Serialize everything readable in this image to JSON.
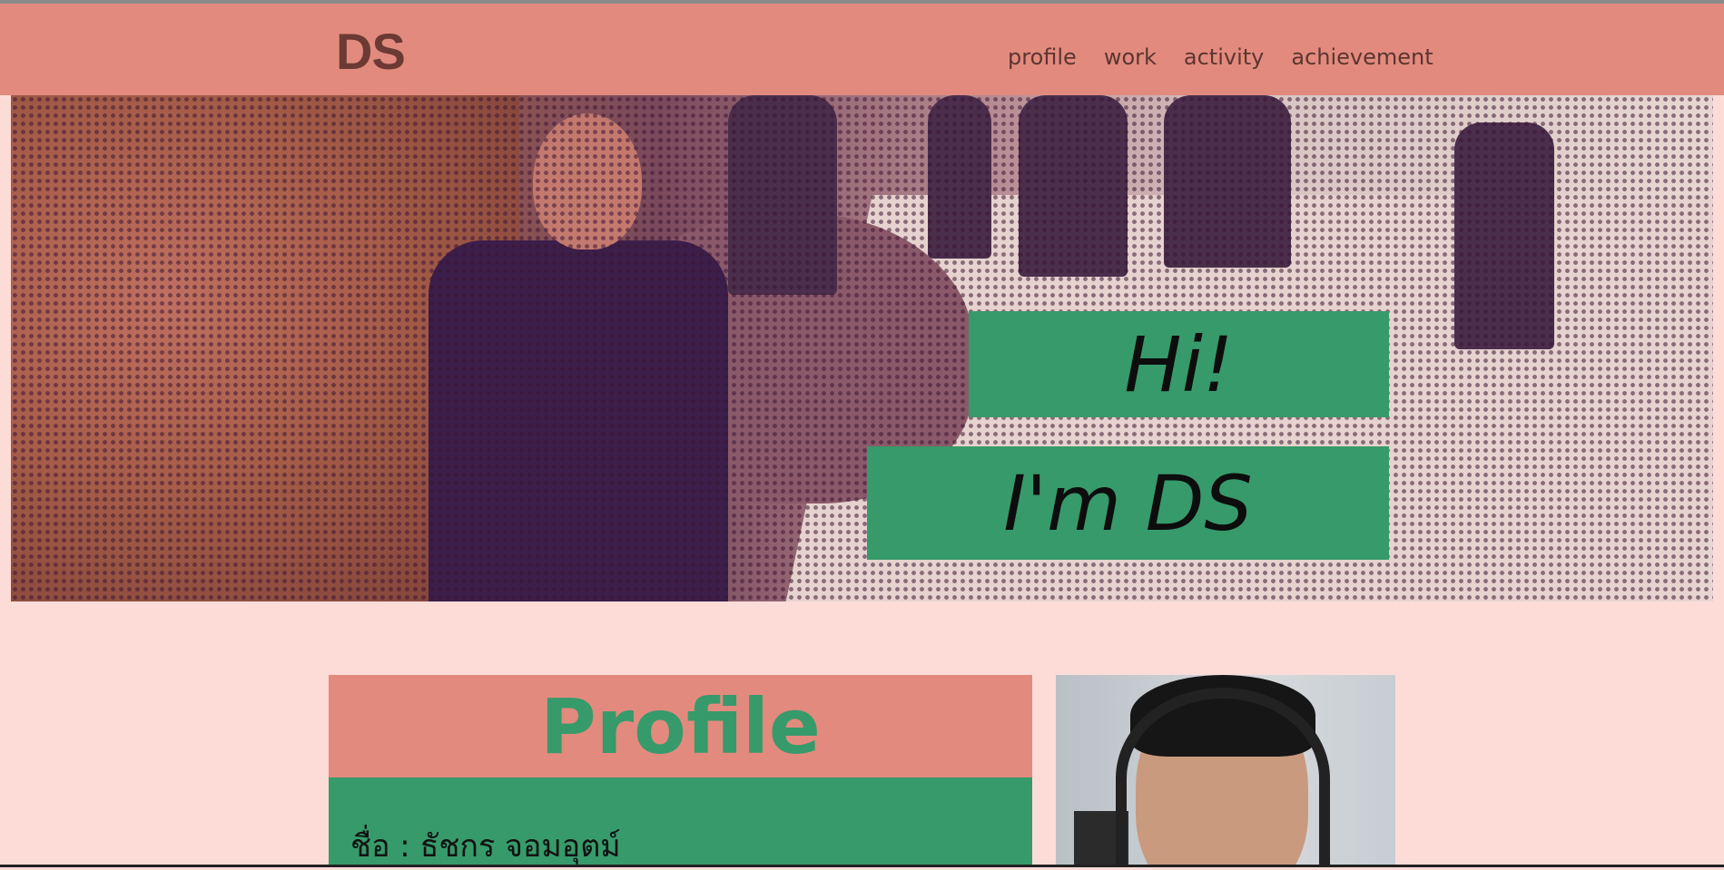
{
  "site": {
    "logo": "DS",
    "nav": [
      "profile",
      "work",
      "activity",
      "achievement"
    ]
  },
  "hero": {
    "greeting": "Hi!",
    "intro": "I'm DS"
  },
  "profile": {
    "heading": "Profile",
    "name_line": "ชื่อ : ธัชกร  จอมอุตม์"
  },
  "colors": {
    "navbar": "#e38a7e",
    "accent_green": "#379a6b",
    "page_bg": "#fddcd8",
    "logo": "#6b3b33"
  }
}
